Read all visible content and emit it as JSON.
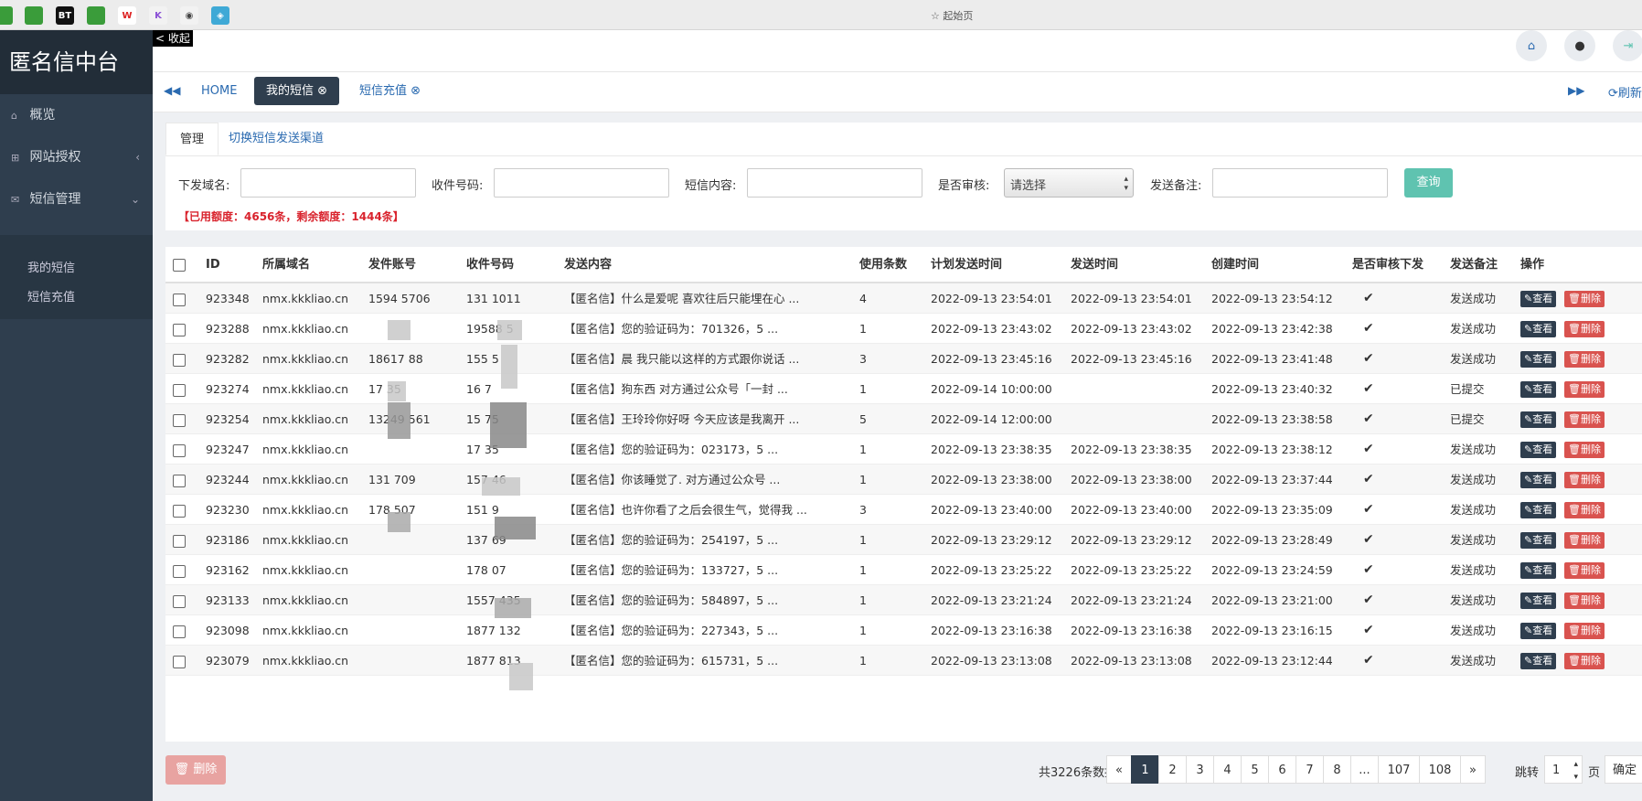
{
  "browser": {
    "title": "起始页",
    "bookmarks": [
      "BT",
      "W",
      "K"
    ]
  },
  "sidebar": {
    "brand": "匿名信中台",
    "collapse_label": "< 收起",
    "items": [
      {
        "label": "概览",
        "icon": "home-icon"
      },
      {
        "label": "网站授权",
        "icon": "sitemap-icon"
      },
      {
        "label": "短信管理",
        "icon": "envelope-icon"
      }
    ],
    "subitems": [
      "我的短信",
      "短信充值"
    ]
  },
  "tabs": {
    "home": "HOME",
    "open": [
      "我的短信",
      "短信充值"
    ],
    "refresh": "刷新"
  },
  "panel": {
    "tabs": [
      "管理",
      "切换短信发送渠道"
    ],
    "filters": {
      "domain_label": "下发域名:",
      "phone_label": "收件号码:",
      "content_label": "短信内容:",
      "audit_label": "是否审核:",
      "audit_value": "请选择",
      "remark_label": "发送备注:"
    },
    "query_button": "查询",
    "quota": "【已用额度：4656条，剩余额度：1444条】"
  },
  "table": {
    "headers": [
      "ID",
      "所属域名",
      "发件账号",
      "收件号码",
      "发送内容",
      "使用条数",
      "计划发送时间",
      "发送时间",
      "创建时间",
      "是否审核下发",
      "发送备注",
      "操作"
    ],
    "view_label": "查看",
    "delete_label": "删除",
    "rows": [
      {
        "id": "923348",
        "domain": "nmx.kkkliao.cn",
        "sender": "1594 5706",
        "to": "131 1011",
        "content": "【匿名信】什么是爱呢 喜欢往后只能埋在心 ...",
        "count": "4",
        "plan": "2022-09-13 23:54:01",
        "sent": "2022-09-13 23:54:01",
        "created": "2022-09-13 23:54:12",
        "remark": "发送成功"
      },
      {
        "id": "923288",
        "domain": "nmx.kkkliao.cn",
        "sender": "",
        "to": "19588 5",
        "content": "【匿名信】您的验证码为：701326，5 ...",
        "count": "1",
        "plan": "2022-09-13 23:43:02",
        "sent": "2022-09-13 23:43:02",
        "created": "2022-09-13 23:42:38",
        "remark": "发送成功"
      },
      {
        "id": "923282",
        "domain": "nmx.kkkliao.cn",
        "sender": "18617 88",
        "to": "155 5",
        "content": "【匿名信】晨 我只能以这样的方式跟你说话 ...",
        "count": "3",
        "plan": "2022-09-13 23:45:16",
        "sent": "2022-09-13 23:45:16",
        "created": "2022-09-13 23:41:48",
        "remark": "发送成功"
      },
      {
        "id": "923274",
        "domain": "nmx.kkkliao.cn",
        "sender": "17 35",
        "to": "16 7",
        "content": "【匿名信】狗东西 对方通过公众号「一封 ...",
        "count": "1",
        "plan": "2022-09-14 10:00:00",
        "sent": "",
        "created": "2022-09-13 23:40:32",
        "remark": "已提交"
      },
      {
        "id": "923254",
        "domain": "nmx.kkkliao.cn",
        "sender": "13249 561",
        "to": "15 75",
        "content": "【匿名信】王玲玲你好呀 今天应该是我离开 ...",
        "count": "5",
        "plan": "2022-09-14 12:00:00",
        "sent": "",
        "created": "2022-09-13 23:38:58",
        "remark": "已提交"
      },
      {
        "id": "923247",
        "domain": "nmx.kkkliao.cn",
        "sender": "",
        "to": "17 35",
        "content": "【匿名信】您的验证码为：023173，5 ...",
        "count": "1",
        "plan": "2022-09-13 23:38:35",
        "sent": "2022-09-13 23:38:35",
        "created": "2022-09-13 23:38:12",
        "remark": "发送成功"
      },
      {
        "id": "923244",
        "domain": "nmx.kkkliao.cn",
        "sender": "131 709",
        "to": "157 46",
        "content": "【匿名信】你该睡觉了. 对方通过公众号 ...",
        "count": "1",
        "plan": "2022-09-13 23:38:00",
        "sent": "2022-09-13 23:38:00",
        "created": "2022-09-13 23:37:44",
        "remark": "发送成功"
      },
      {
        "id": "923230",
        "domain": "nmx.kkkliao.cn",
        "sender": "178 507",
        "to": "151 9",
        "content": "【匿名信】也许你看了之后会很生气，觉得我 ...",
        "count": "3",
        "plan": "2022-09-13 23:40:00",
        "sent": "2022-09-13 23:40:00",
        "created": "2022-09-13 23:35:09",
        "remark": "发送成功"
      },
      {
        "id": "923186",
        "domain": "nmx.kkkliao.cn",
        "sender": "",
        "to": "137 69",
        "content": "【匿名信】您的验证码为：254197，5 ...",
        "count": "1",
        "plan": "2022-09-13 23:29:12",
        "sent": "2022-09-13 23:29:12",
        "created": "2022-09-13 23:28:49",
        "remark": "发送成功"
      },
      {
        "id": "923162",
        "domain": "nmx.kkkliao.cn",
        "sender": "",
        "to": "178 07",
        "content": "【匿名信】您的验证码为：133727，5 ...",
        "count": "1",
        "plan": "2022-09-13 23:25:22",
        "sent": "2022-09-13 23:25:22",
        "created": "2022-09-13 23:24:59",
        "remark": "发送成功"
      },
      {
        "id": "923133",
        "domain": "nmx.kkkliao.cn",
        "sender": "",
        "to": "1557 435",
        "content": "【匿名信】您的验证码为：584897，5 ...",
        "count": "1",
        "plan": "2022-09-13 23:21:24",
        "sent": "2022-09-13 23:21:24",
        "created": "2022-09-13 23:21:00",
        "remark": "发送成功"
      },
      {
        "id": "923098",
        "domain": "nmx.kkkliao.cn",
        "sender": "",
        "to": "1877 132",
        "content": "【匿名信】您的验证码为：227343，5 ...",
        "count": "1",
        "plan": "2022-09-13 23:16:38",
        "sent": "2022-09-13 23:16:38",
        "created": "2022-09-13 23:16:15",
        "remark": "发送成功"
      },
      {
        "id": "923079",
        "domain": "nmx.kkkliao.cn",
        "sender": "",
        "to": "1877 813",
        "content": "【匿名信】您的验证码为：615731，5 ...",
        "count": "1",
        "plan": "2022-09-13 23:13:08",
        "sent": "2022-09-13 23:13:08",
        "created": "2022-09-13 23:12:44",
        "remark": "发送成功"
      }
    ]
  },
  "footer": {
    "delete_button": "删除",
    "total": "共3226条数据",
    "pages": [
      "«",
      "1",
      "2",
      "3",
      "4",
      "5",
      "6",
      "7",
      "8",
      "...",
      "107",
      "108",
      "»"
    ],
    "jump_label": "跳转",
    "jump_value": "1",
    "page_label": "页",
    "confirm": "确定"
  },
  "colors": {
    "sidebar": "#2f3e4e",
    "accent": "#2a6ab0",
    "query": "#5fc3b0",
    "danger": "#d9534f",
    "quota": "#d9232d"
  }
}
